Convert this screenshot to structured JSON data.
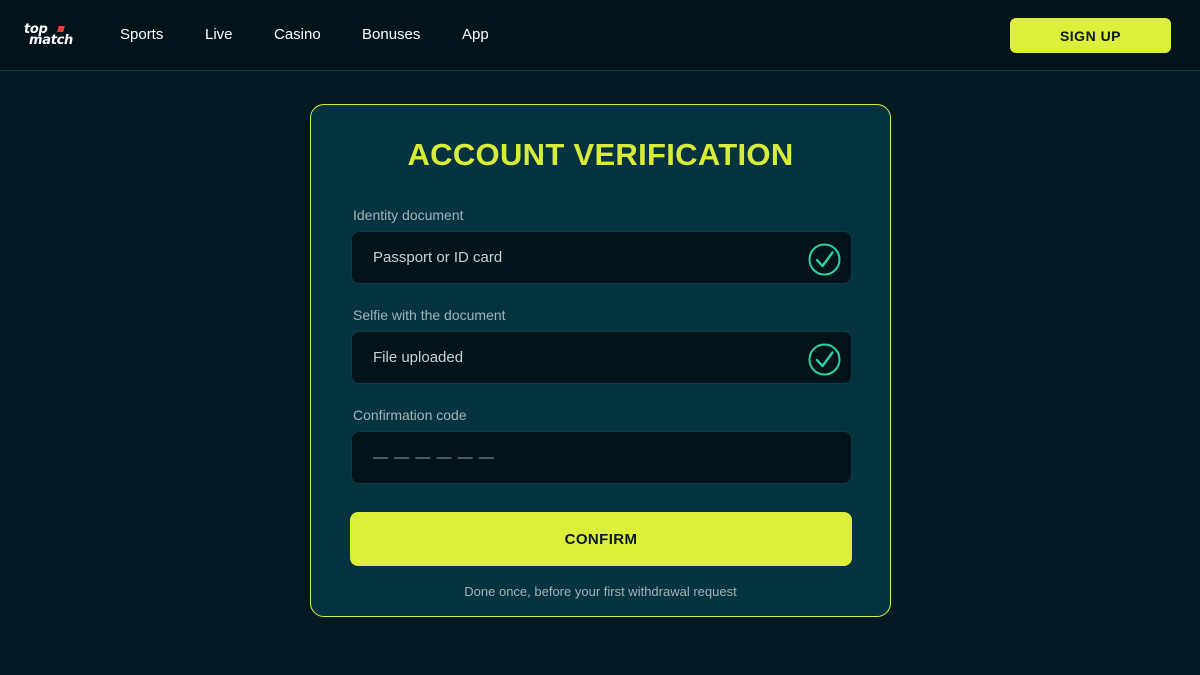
{
  "header": {
    "logo": {
      "line1": "top",
      "line2": "match"
    },
    "nav": [
      {
        "label": "Sports"
      },
      {
        "label": "Live"
      },
      {
        "label": "Casino"
      },
      {
        "label": "Bonuses"
      },
      {
        "label": "App"
      }
    ],
    "signup_label": "SIGN UP"
  },
  "verification": {
    "title": "ACCOUNT VERIFICATION",
    "fields": [
      {
        "label": "Identity document",
        "value": "Passport or ID card",
        "status": "check-icon"
      },
      {
        "label": "Selfie with the document",
        "value": "File uploaded",
        "status": "check-icon"
      },
      {
        "label": "Confirmation code",
        "value": "— — — — — —"
      }
    ],
    "confirm_label": "CONFIRM",
    "note": "Done once, before your first withdrawal request"
  },
  "colors": {
    "accent": "#dbef3b",
    "background": "#031a22",
    "card": "#063340",
    "check": "#2ed3a0",
    "logo_dot": "#ff3b3b"
  }
}
